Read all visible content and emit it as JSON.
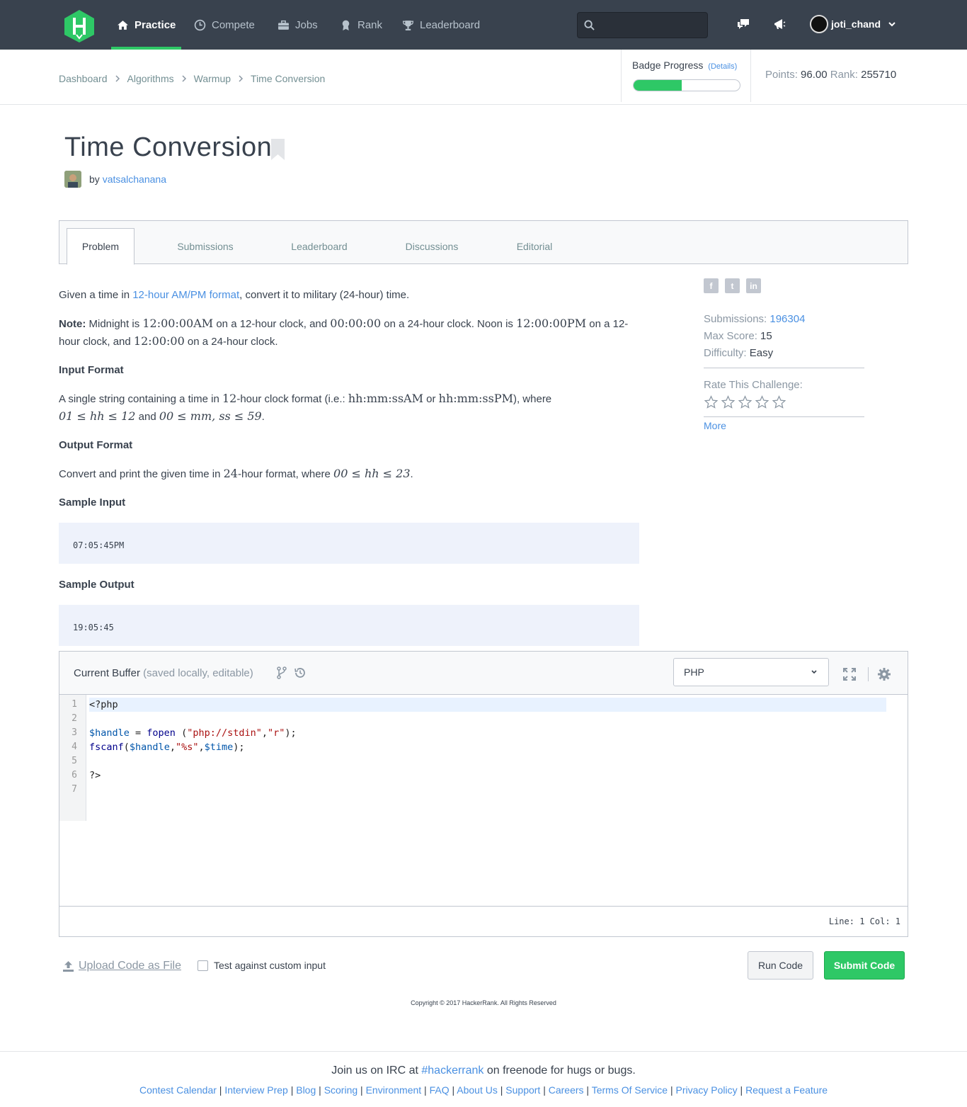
{
  "nav": {
    "items": [
      {
        "label": "Practice",
        "icon": "home-icon"
      },
      {
        "label": "Compete",
        "icon": "clock-icon"
      },
      {
        "label": "Jobs",
        "icon": "briefcase-icon"
      },
      {
        "label": "Rank",
        "icon": "medal-icon"
      },
      {
        "label": "Leaderboard",
        "icon": "trophy-icon"
      }
    ],
    "active": "Practice",
    "search_placeholder": "",
    "username": "joti_chand"
  },
  "breadcrumb": [
    "Dashboard",
    "Algorithms",
    "Warmup",
    "Time Conversion"
  ],
  "badge": {
    "title": "Badge Progress",
    "details": "(Details)",
    "progress": 0.45
  },
  "stats": {
    "points_label": "Points:",
    "points": "96.00",
    "rank_label": "Rank:",
    "rank": "255710"
  },
  "challenge": {
    "title": "Time Conversion",
    "by": "by",
    "author": "vatsalchanana"
  },
  "tabs": [
    "Problem",
    "Submissions",
    "Leaderboard",
    "Discussions",
    "Editorial"
  ],
  "problem": {
    "intro_pre": "Given a time in ",
    "intro_link": "12-hour AM/PM format",
    "intro_post": ", convert it to military (24-hour) time.",
    "note_label": "Note:",
    "note_1": " Midnight is ",
    "note_m1": "12:00:00AM",
    "note_2": " on a 12-hour clock, and ",
    "note_m2": "00:00:00",
    "note_3": " on a 24-hour clock. Noon is ",
    "note_m3": "12:00:00PM",
    "note_4": " on a 12-hour clock, and ",
    "note_m4": "12:00:00",
    "note_5": " on a 24-hour clock.",
    "input_heading": "Input Format",
    "input_1": "A single string containing a time in ",
    "input_m1": "12",
    "input_2": "-hour clock format (i.e.: ",
    "input_m2": "hh:mm:ssAM",
    "input_3": " or ",
    "input_m3": "hh:mm:ssPM",
    "input_4": "), where",
    "input_m4": "01 ≤ hh ≤ 12",
    "input_5": " and ",
    "input_m5": "00 ≤ mm, ss ≤ 59",
    "input_6": ".",
    "output_heading": "Output Format",
    "output_1": "Convert and print the given time in ",
    "output_m1": "24",
    "output_2": "-hour format, where ",
    "output_m2": "00 ≤ hh ≤ 23",
    "output_3": ".",
    "sample_input_heading": "Sample Input",
    "sample_input": "07:05:45PM",
    "sample_output_heading": "Sample Output",
    "sample_output": "19:05:45"
  },
  "side": {
    "social": [
      "facebook-icon",
      "twitter-icon",
      "linkedin-icon"
    ],
    "submissions_label": "Submissions:",
    "submissions": "196304",
    "max_score_label": "Max Score:",
    "max_score": "15",
    "difficulty_label": "Difficulty:",
    "difficulty": "Easy",
    "rate_label": "Rate This Challenge:",
    "stars": 5,
    "more": "More"
  },
  "editor": {
    "buffer_label": "Current Buffer",
    "buffer_note": " (saved locally, editable)",
    "language": "PHP",
    "line_numbers": [
      "1",
      "2",
      "3",
      "4",
      "5",
      "6",
      "7"
    ],
    "position": "Line: 1 Col: 1"
  },
  "actions": {
    "upload": "Upload Code as File",
    "custom_input": "Test against custom input",
    "run": "Run Code",
    "submit": "Submit Code"
  },
  "copyright": "Copyright © 2017 HackerRank. All Rights Reserved",
  "footer": {
    "irc_pre": "Join us on IRC at ",
    "irc_link": "#hackerrank",
    "irc_post": " on freenode for hugs or bugs.",
    "links": [
      "Contest Calendar",
      "Interview Prep",
      "Blog",
      "Scoring",
      "Environment",
      "FAQ",
      "About Us",
      "Support",
      "Careers",
      "Terms Of Service",
      "Privacy Policy",
      "Request a Feature"
    ]
  },
  "colors": {
    "brand": "#2ec866",
    "nav_bg": "#39424e",
    "link": "#4a90e2"
  }
}
